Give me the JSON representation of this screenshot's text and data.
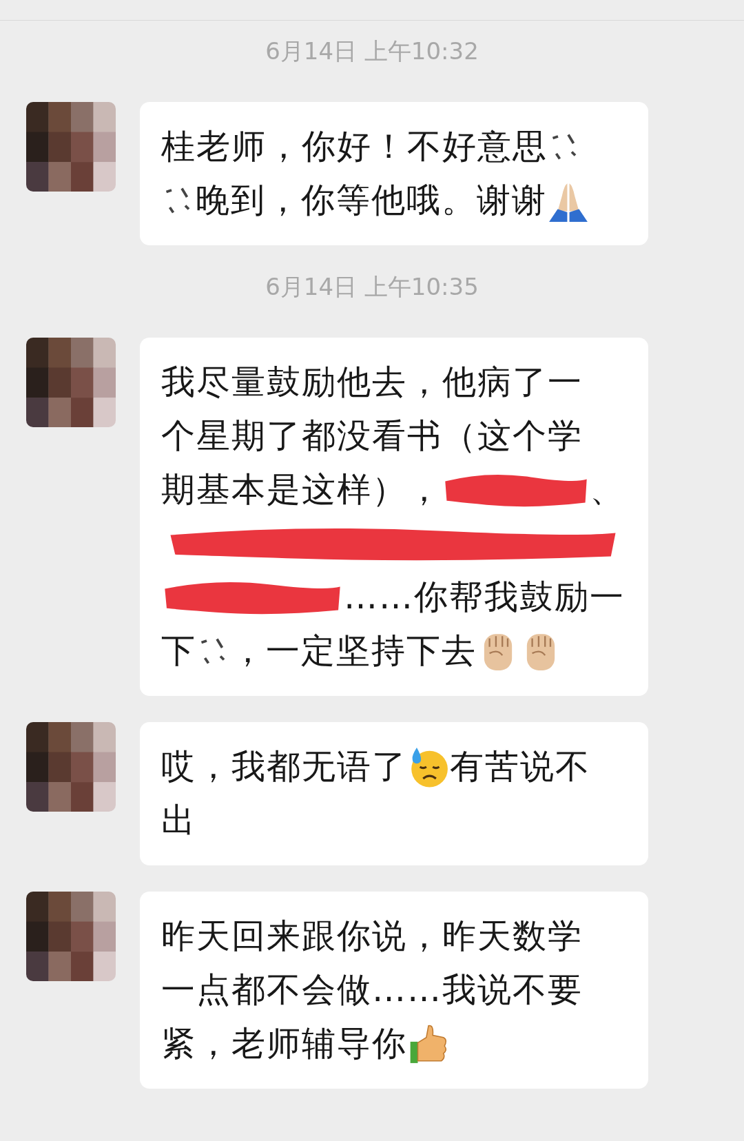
{
  "messages": [
    {
      "kind": "time",
      "text": "6月14日 上午10:32"
    },
    {
      "kind": "bubble",
      "lines": [
        [
          {
            "kind": "text",
            "text": "桂老师，你好！不好意思"
          },
          {
            "kind": "erased"
          }
        ],
        [
          {
            "kind": "erased"
          },
          {
            "kind": "text",
            "text": "晚到，你等他哦。谢谢"
          },
          {
            "kind": "pray"
          }
        ]
      ]
    },
    {
      "kind": "time",
      "text": "6月14日 上午10:35"
    },
    {
      "kind": "bubble",
      "lines": [
        [
          {
            "kind": "text",
            "text": "我尽量鼓励他去，他病了一"
          }
        ],
        [
          {
            "kind": "text",
            "text": "个星期了都没看书（这个学"
          }
        ],
        [
          {
            "kind": "text",
            "text": "期基本是这样），"
          },
          {
            "kind": "scribble"
          },
          {
            "kind": "text",
            "text": "、"
          }
        ],
        [
          {
            "kind": "scribble"
          }
        ],
        [
          {
            "kind": "scribble"
          },
          {
            "kind": "text",
            "text": "……你帮我鼓励一"
          }
        ],
        [
          {
            "kind": "text",
            "text": "下"
          },
          {
            "kind": "erased"
          },
          {
            "kind": "text",
            "text": "，一定坚持下去"
          },
          {
            "kind": "fist"
          },
          {
            "kind": "fist"
          }
        ]
      ]
    },
    {
      "kind": "bubble",
      "lines": [
        [
          {
            "kind": "text",
            "text": "哎，我都无语了"
          },
          {
            "kind": "sweat"
          },
          {
            "kind": "text",
            "text": "有苦说不"
          }
        ],
        [
          {
            "kind": "text",
            "text": "出"
          }
        ]
      ]
    },
    {
      "kind": "bubble",
      "lines": [
        [
          {
            "kind": "text",
            "text": "昨天回来跟你说，昨天数学"
          }
        ],
        [
          {
            "kind": "text",
            "text": "一点都不会做……我说不要"
          }
        ],
        [
          {
            "kind": "text",
            "text": "紧，老师辅导你"
          },
          {
            "kind": "thumbs"
          }
        ]
      ]
    }
  ]
}
